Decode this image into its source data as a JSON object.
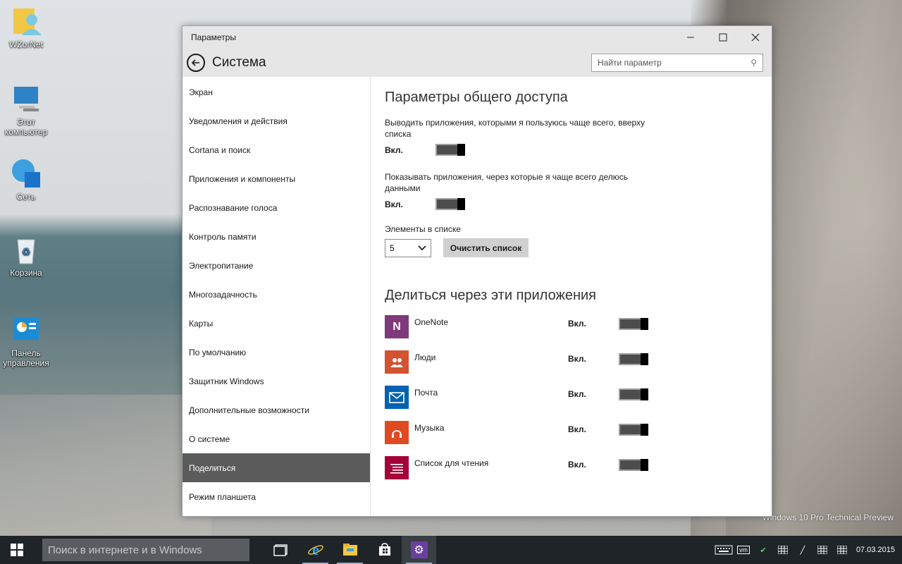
{
  "desktop": {
    "icons": [
      {
        "label": "WZorNet",
        "icon": "user-folder-icon"
      },
      {
        "label": "Этот компьютер",
        "icon": "computer-icon"
      },
      {
        "label": "Сеть",
        "icon": "network-icon"
      },
      {
        "label": "Корзина",
        "icon": "recycle-bin-icon"
      },
      {
        "label": "Панель управления",
        "icon": "control-panel-icon"
      }
    ],
    "watermark": "Windows 10 Pro Technical Preview"
  },
  "window": {
    "title": "Параметры",
    "page_title": "Система",
    "search_placeholder": "Найти параметр"
  },
  "nav": {
    "items": [
      "Экран",
      "Уведомления и действия",
      "Cortana и поиск",
      "Приложения и компоненты",
      "Распознавание голоса",
      "Контроль памяти",
      "Электропитание",
      "Многозадачность",
      "Карты",
      "По умолчанию",
      "Защитник Windows",
      "Дополнительные возможности",
      "О системе",
      "Поделиться",
      "Режим планшета"
    ],
    "active": "Поделиться"
  },
  "content": {
    "section1_title": "Параметры общего доступа",
    "setting1_desc": "Выводить приложения, которыми я пользуюсь чаще всего, вверху списка",
    "setting1_state": "Вкл.",
    "setting2_desc": "Показывать приложения, через которые я чаще всего делюсь данными",
    "setting2_state": "Вкл.",
    "list_label": "Элементы в списке",
    "list_count": "5",
    "clear_button": "Очистить список",
    "section2_title": "Делиться через эти приложения",
    "apps": [
      {
        "name": "OneNote",
        "state": "Вкл.",
        "color": "#80397b",
        "icon": "onenote-icon"
      },
      {
        "name": "Люди",
        "state": "Вкл.",
        "color": "#d35230",
        "icon": "people-icon"
      },
      {
        "name": "Почта",
        "state": "Вкл.",
        "color": "#0063b1",
        "icon": "mail-icon"
      },
      {
        "name": "Музыка",
        "state": "Вкл.",
        "color": "#e04a21",
        "icon": "music-icon"
      },
      {
        "name": "Список для чтения",
        "state": "Вкл.",
        "color": "#a4003a",
        "icon": "reading-list-icon"
      }
    ]
  },
  "taskbar": {
    "search_placeholder": "Поиск в интернете и в Windows",
    "apps": [
      "task-view-icon",
      "internet-explorer-icon",
      "file-explorer-icon",
      "store-icon",
      "settings-icon"
    ],
    "clock_date": "07.03.2015"
  },
  "colors": {
    "taskbar_bg": "#1f2428",
    "nav_active_bg": "#5b5b5b",
    "header_bg": "#e6e6e6"
  }
}
